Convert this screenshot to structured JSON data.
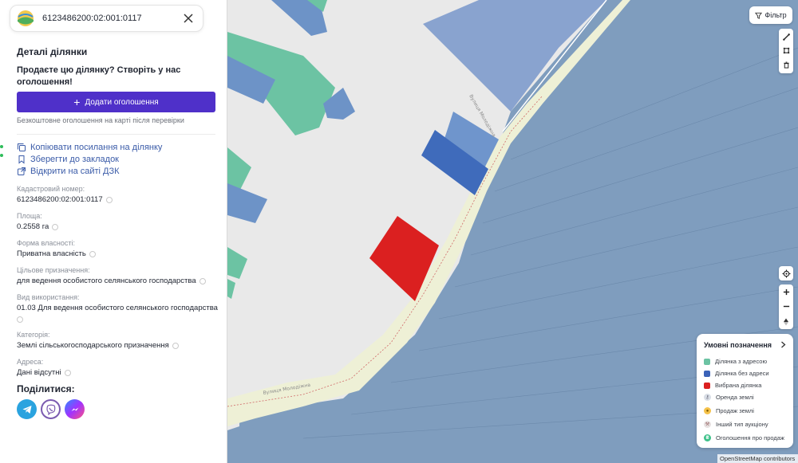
{
  "search": {
    "value": "6123486200:02:001:0117"
  },
  "panel": {
    "title": "Деталі ділянки",
    "promo": "Продаєте цю ділянку? Створіть у нас оголошення!",
    "add_button": "Додати оголошення",
    "free_note": "Безкоштовне оголошення на карті після перевірки",
    "links": {
      "copy": "Копіювати посилання на ділянку",
      "bookmark": "Зберегти до закладок",
      "open_dzk": "Відкрити на сайті ДЗК"
    },
    "fields": {
      "cadastral": {
        "label": "Кадастровий номер:",
        "value": "6123486200:02:001:0117"
      },
      "area": {
        "label": "Площа:",
        "value": "0.2558 га"
      },
      "ownership": {
        "label": "Форма власності:",
        "value": "Приватна власність"
      },
      "purpose": {
        "label": "Цільове призначення:",
        "value": "для ведення особистого селянського господарства"
      },
      "usage": {
        "label": "Вид використання:",
        "value": "01.03 Для ведення особистого селянського господарства"
      },
      "category": {
        "label": "Категорія:",
        "value": "Землі сільськогосподарського призначення"
      },
      "address": {
        "label": "Адреса:",
        "value": "Дані відсутні"
      }
    },
    "share_title": "Поділитися:",
    "share_icons": [
      "telegram-icon",
      "viber-icon",
      "messenger-icon"
    ]
  },
  "map": {
    "filter_label": "Фільтр",
    "street_labels": [
      "Вулиця Молодіжна",
      "Вулиця Молодіжна"
    ],
    "attribution": "OpenStreetMap contributors",
    "colors": {
      "with_address": "#6cc3a3",
      "without_address": "#4a72c0",
      "selected": "#db2020",
      "large_parcel": "#7e9cbd",
      "road_strip": "#ecefd4",
      "background": "#e9e9e9"
    }
  },
  "legend": {
    "title": "Умовні позначення",
    "items": [
      {
        "label": "Ділянка з адресою",
        "color": "#6cc3a3"
      },
      {
        "label": "Ділянка без адреси",
        "color": "#3b63b8"
      },
      {
        "label": "Вибрана ділянка",
        "color": "#db2020"
      },
      {
        "label": "Оренда землі",
        "color": "#d9dee6",
        "icon": "key-icon"
      },
      {
        "label": "Продаж землі",
        "color": "#f5c24a",
        "icon": "coin-icon"
      },
      {
        "label": "Інший тип аукціону",
        "color": "#e6e0e0",
        "icon": "gavel-icon"
      },
      {
        "label": "Оголошення про продаж",
        "color": "#3ec18a",
        "icon": "hryvnia-icon"
      }
    ]
  }
}
